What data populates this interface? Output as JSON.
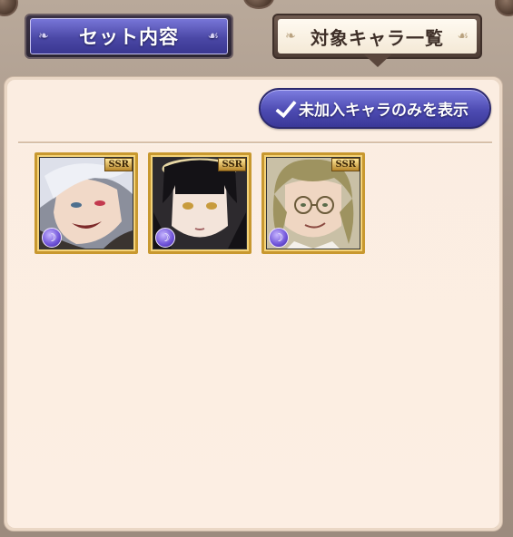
{
  "tabs": {
    "set_contents": "セット内容",
    "target_characters": "対象キャラ一覧"
  },
  "panel": {
    "toggle_label": "未加入キャラのみを表示",
    "toggle_checked": true,
    "cards": [
      {
        "rarity": "SSR",
        "element": "dark",
        "element_icon": "☽",
        "hair": "silver"
      },
      {
        "rarity": "SSR",
        "element": "dark",
        "element_icon": "☽",
        "hair": "black"
      },
      {
        "rarity": "SSR",
        "element": "dark",
        "element_icon": "☽",
        "hair": "blonde"
      }
    ]
  },
  "colors": {
    "accent_blue": "#4d4bb2",
    "panel_bg": "#fbebde",
    "card_frame": "#c8982f"
  }
}
